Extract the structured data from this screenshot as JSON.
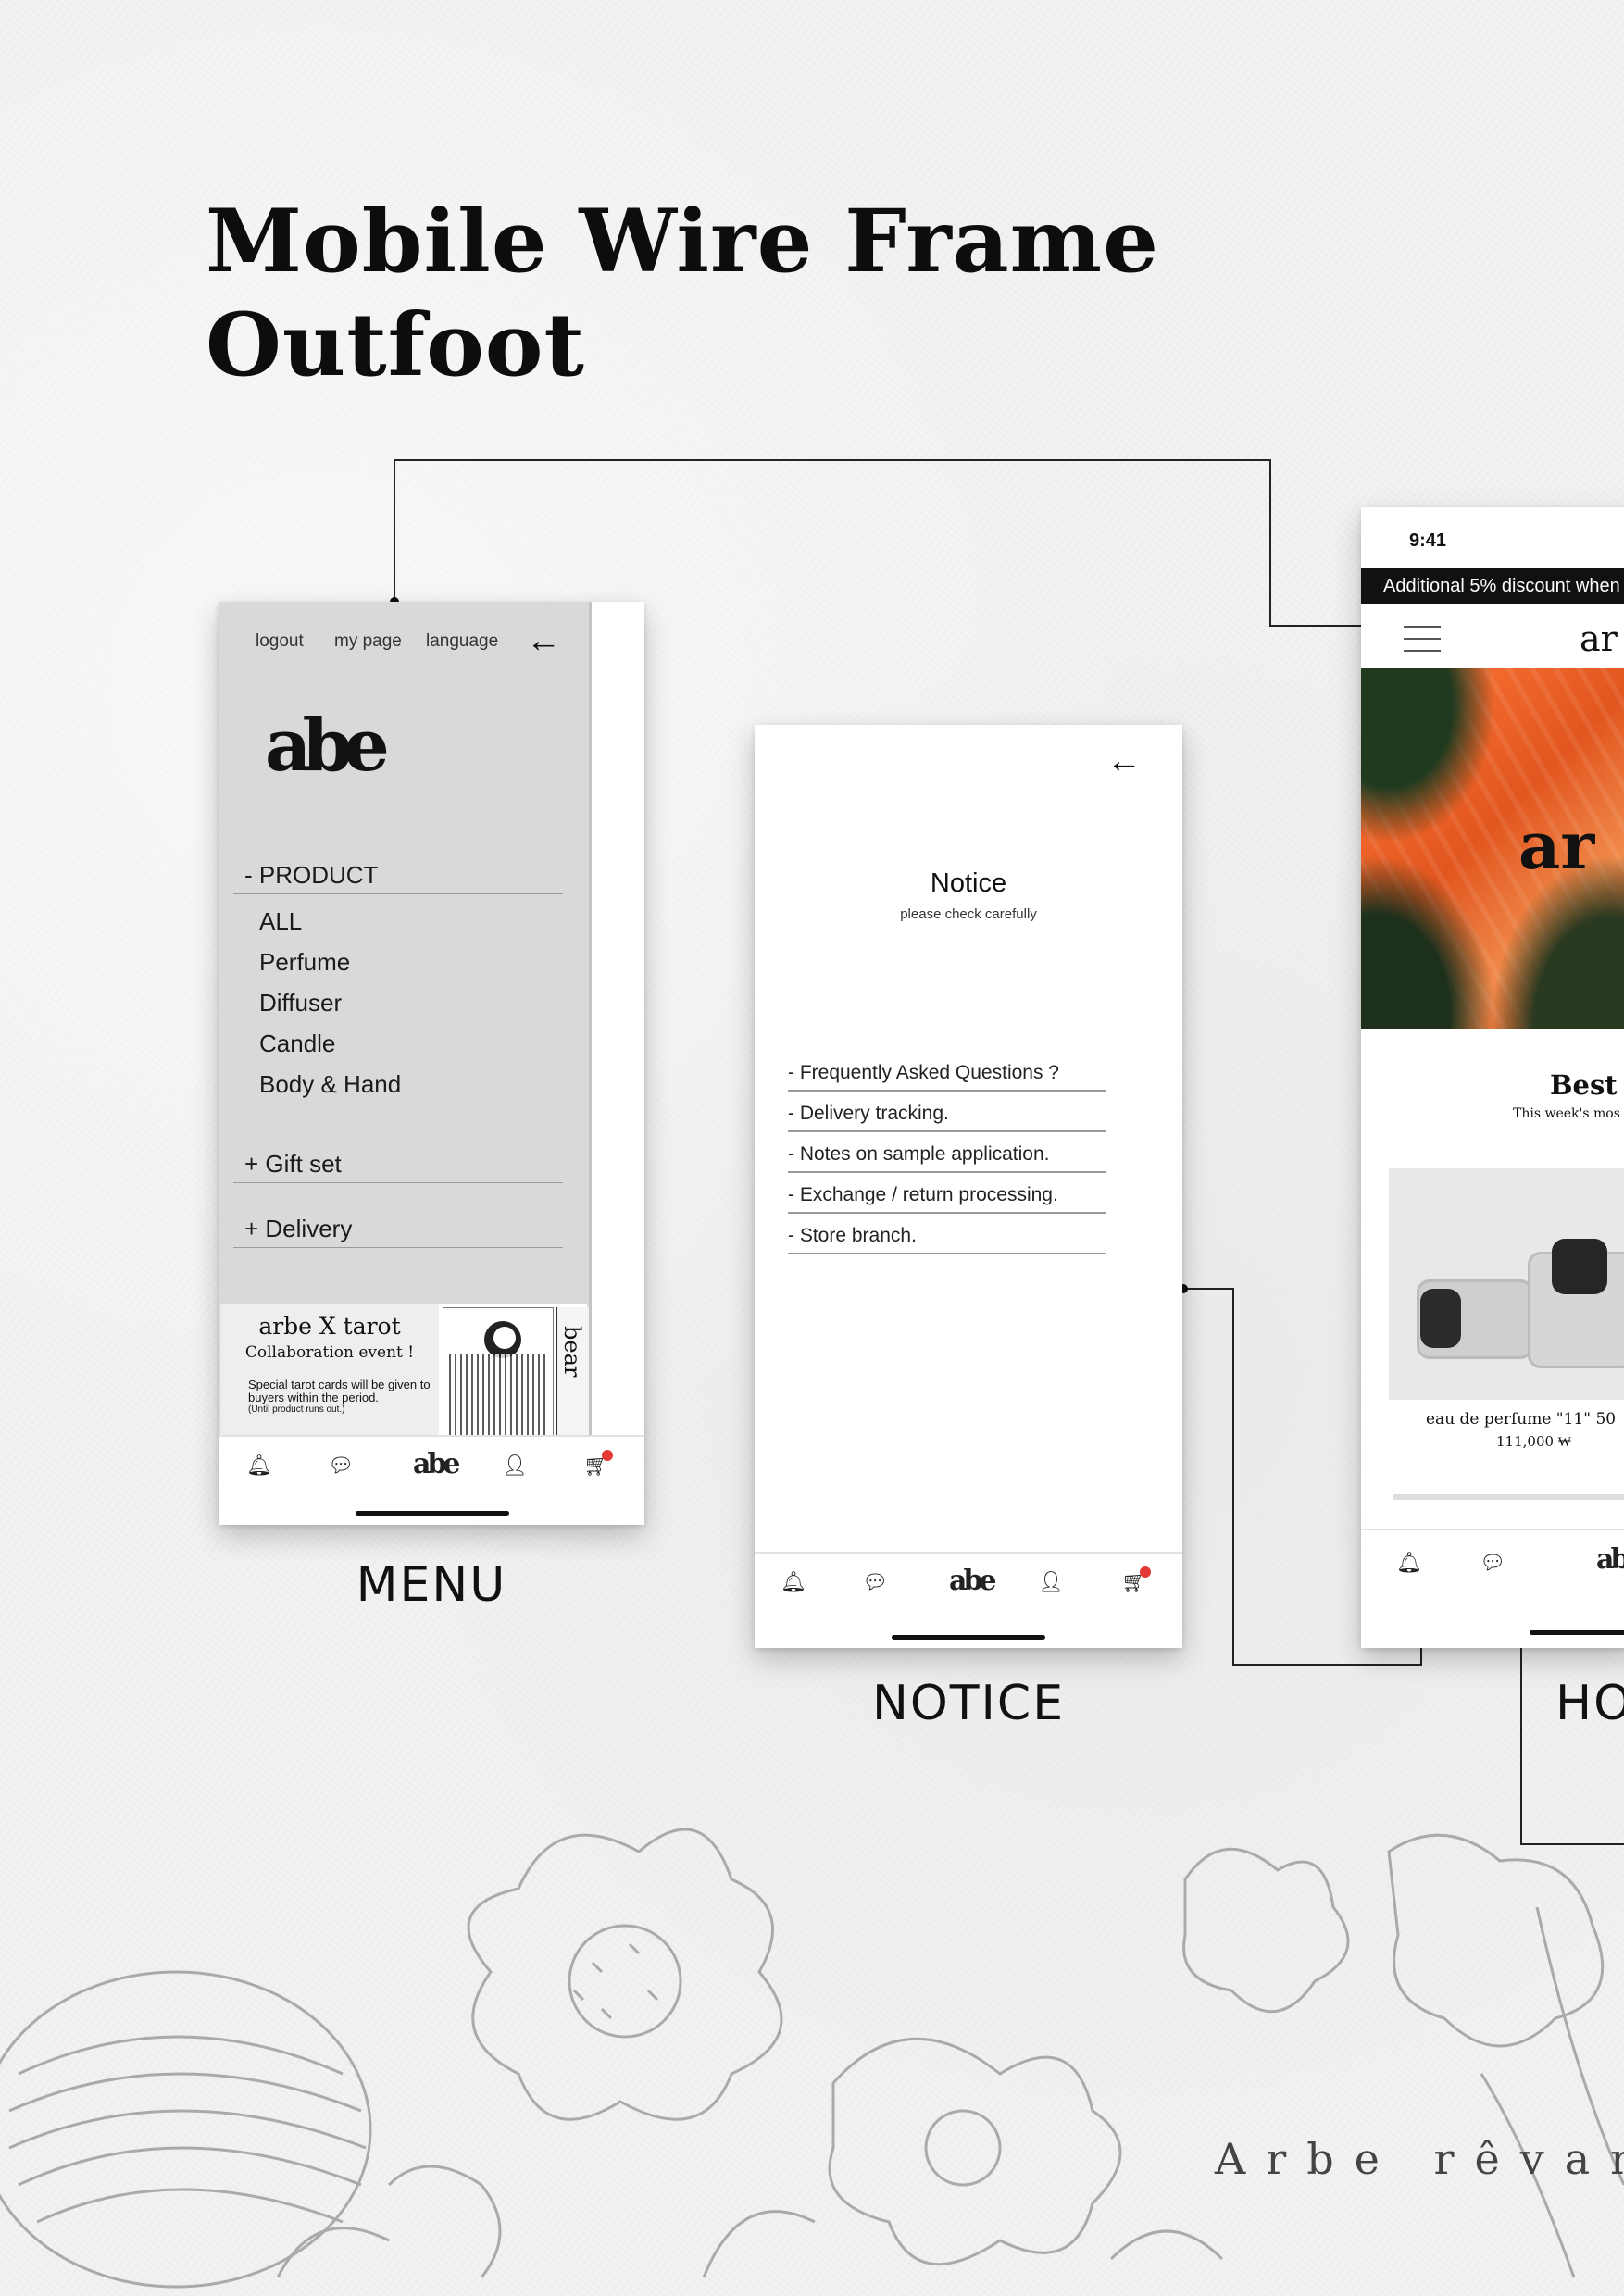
{
  "page": {
    "title_line1": "Mobile Wire Frame",
    "title_line2": "Outfoot",
    "signature": "Arbe rêvan"
  },
  "captions": {
    "menu": "MENU",
    "notice": "NOTICE",
    "home": "HO"
  },
  "menu_screen": {
    "top_links": [
      "logout",
      "my page",
      "language"
    ],
    "back_icon": "arrow-left-icon",
    "logo_text": "abe",
    "sections": [
      {
        "label": "- PRODUCT",
        "items": [
          "ALL",
          "Perfume",
          "Diffuser",
          "Candle",
          "Body & Hand"
        ]
      },
      {
        "label": "+ Gift set"
      },
      {
        "label": "+ Delivery"
      }
    ],
    "promo": {
      "title": "arbe X tarot",
      "subtitle": "Collaboration event !",
      "body": "Special tarot cards will be given to buyers within the period.",
      "note": "(Until product runs out.)",
      "side_text": "bear"
    }
  },
  "tab_bar": {
    "icons": [
      "bell-icon",
      "chat-icon",
      "logo-icon",
      "user-icon",
      "cart-icon"
    ],
    "logo_text": "abe"
  },
  "notice_screen": {
    "title": "Notice",
    "subtitle": "please check carefully",
    "items": [
      "- Frequently Asked Questions ?",
      "- Delivery tracking.",
      "- Notes on sample application.",
      "- Exchange / return processing.",
      "- Store branch."
    ]
  },
  "home_screen": {
    "time": "9:41",
    "ticker": "Additional 5% discount when",
    "brand": "ar",
    "hero_mark": "ar",
    "best_title": "Best s",
    "best_sub": "This week's mos",
    "product_name": "eau de perfume \"11\" 50",
    "product_price": "111,000 ₩"
  },
  "colors": {
    "background": "#f2f2f1",
    "menu_panel": "#d9d9d9",
    "badge": "#e53935",
    "ticker_bg": "#111111",
    "hero": "#e2561f"
  }
}
